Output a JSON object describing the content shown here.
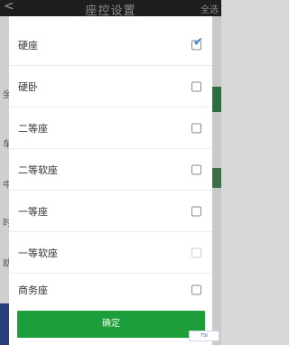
{
  "header": {
    "title": "座控设置",
    "back_label": "<",
    "right_label": "全选"
  },
  "background": {
    "left_snippets": [
      "坐",
      "车",
      "中",
      "时",
      "助"
    ]
  },
  "dialog": {
    "options": [
      {
        "label": "硬座",
        "checked": true,
        "enabled": true
      },
      {
        "label": "硬卧",
        "checked": false,
        "enabled": true
      },
      {
        "label": "二等座",
        "checked": false,
        "enabled": true
      },
      {
        "label": "二等软座",
        "checked": false,
        "enabled": true
      },
      {
        "label": "一等座",
        "checked": false,
        "enabled": true
      },
      {
        "label": "一等软座",
        "checked": false,
        "enabled": false
      },
      {
        "label": "商务座",
        "checked": false,
        "enabled": true
      }
    ],
    "confirm_label": "确定",
    "check_glyph": "✔"
  },
  "watermark": {
    "text": "TSI"
  },
  "colors": {
    "confirm": "#1d9e3b",
    "check": "#3d7ec9"
  }
}
